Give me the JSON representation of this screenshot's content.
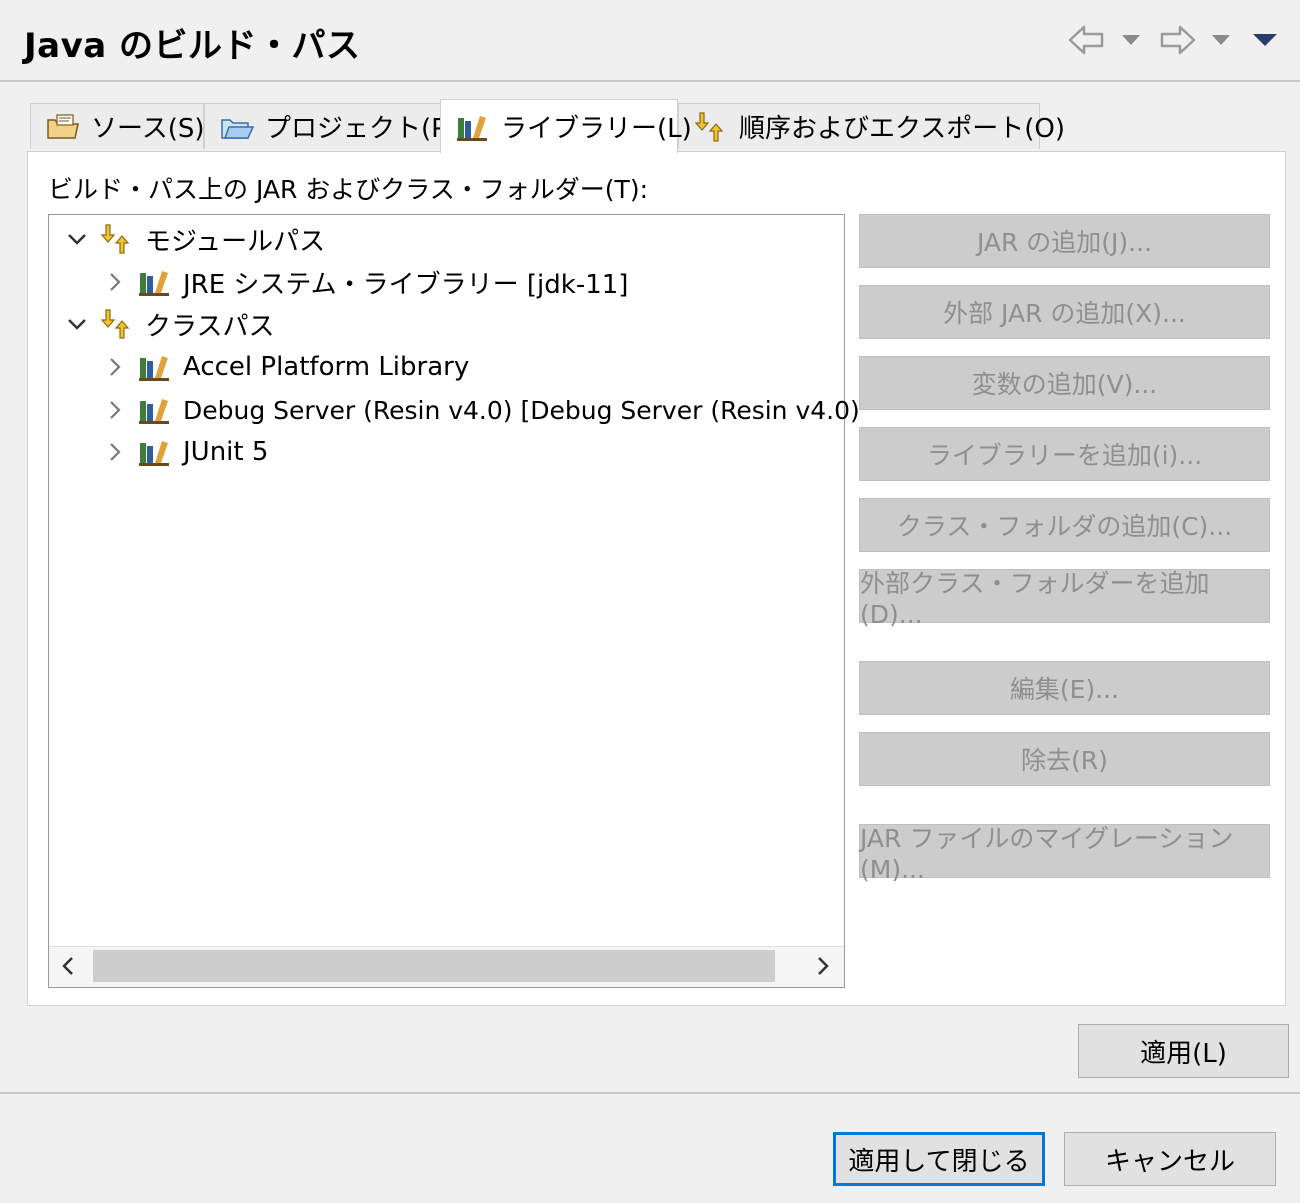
{
  "header": {
    "title": "Java のビルド・パス"
  },
  "tabs": [
    {
      "label": "ソース(S)",
      "icon": "source-folder-icon"
    },
    {
      "label": "プロジェクト(P)",
      "icon": "project-folder-icon"
    },
    {
      "label": "ライブラリー(L)",
      "icon": "library-icon",
      "active": true
    },
    {
      "label": "順序およびエクスポート(O)",
      "icon": "order-export-icon"
    }
  ],
  "panel": {
    "label": "ビルド・パス上の JAR およびクラス・フォルダー(T):"
  },
  "tree": {
    "items": [
      {
        "label": "モジュールパス",
        "expanded": true,
        "icon": "classpath-container-icon"
      },
      {
        "label": "JRE システム・ライブラリー [jdk-11]",
        "icon": "library-icon"
      },
      {
        "label": "クラスパス",
        "expanded": true,
        "icon": "classpath-container-icon"
      },
      {
        "label": "Accel Platform Library",
        "icon": "library-icon"
      },
      {
        "label": "Debug Server (Resin v4.0) [Debug Server (Resin v4.0)",
        "icon": "library-icon"
      },
      {
        "label": "JUnit 5",
        "icon": "library-icon"
      }
    ]
  },
  "buttons": [
    "JAR の追加(J)...",
    "外部 JAR の追加(X)...",
    "変数の追加(V)...",
    "ライブラリーを追加(i)...",
    "クラス・フォルダの追加(C)...",
    "外部クラス・フォルダーを追加(D)...",
    "編集(E)...",
    "除去(R)",
    "JAR ファイルのマイグレーション(M)..."
  ],
  "apply": {
    "label": "適用(L)"
  },
  "footer": {
    "apply_close": "適用して閉じる",
    "cancel": "キャンセル"
  }
}
